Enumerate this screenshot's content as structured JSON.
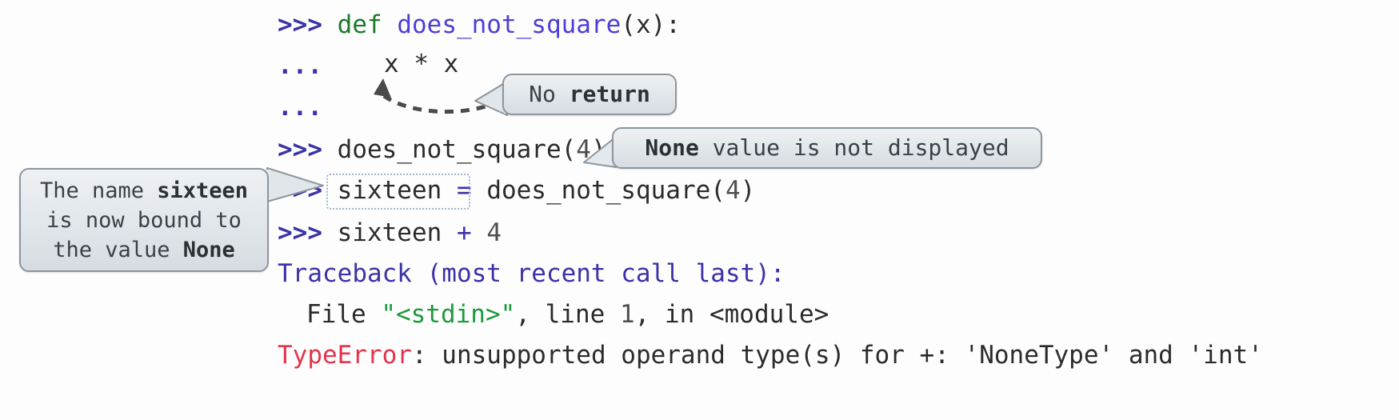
{
  "console": {
    "lines": [
      {
        "id": "def-line",
        "prompt": ">>> ",
        "keyword": "def ",
        "funcname": "does_not_square",
        "rest": "(x):"
      },
      {
        "id": "cont-line-1",
        "prompt": "... ",
        "body": ""
      },
      {
        "id": "cont-line-2",
        "prompt": "... ",
        "body": ""
      },
      {
        "id": "call-line",
        "prompt": ">>> ",
        "body": "does_not_square(4)"
      },
      {
        "id": "assign-line",
        "prompt": ">>> ",
        "body": "sixteen = does_not_square(4)"
      },
      {
        "id": "add-line",
        "prompt": ">>> ",
        "body": "sixteen + 4"
      },
      {
        "id": "traceback-line",
        "prompt": "",
        "body": "Traceback (most recent call last):"
      },
      {
        "id": "file-line",
        "prompt": "",
        "body": "File \"<stdin>\", line 1, in <module>"
      },
      {
        "id": "error-line",
        "prompt": "",
        "body": "TypeError: unsupported operand type(s) for +: 'NoneType' and 'int'"
      }
    ],
    "body_expr": "x * x",
    "def_prompt": ">>> ",
    "def_keyword": "def",
    "def_funcname": "does_not_square",
    "def_paren_open": "(",
    "def_arg": "x",
    "def_paren_close": "):",
    "cont_prompt": "...",
    "call_prompt": ">>> ",
    "call_name": "does_not_square",
    "call_open": "(",
    "call_arg": "4",
    "call_close": ")",
    "assign_prompt": ">>> ",
    "assign_target": "sixteen",
    "assign_op": " = ",
    "assign_call_name": "does_not_square",
    "assign_open": "(",
    "assign_arg": "4",
    "assign_close": ")",
    "add_prompt": ">>> ",
    "add_target": "sixteen",
    "add_op": " + ",
    "add_num": "4",
    "traceback_text": "Traceback (most recent call last):",
    "file_word": "File ",
    "file_name": "\"<stdin>\"",
    "file_mid": ", line ",
    "file_lineno": "1",
    "file_tail": ", in <module>",
    "error_name": "TypeError",
    "error_message": ": unsupported operand type(s) for +: 'NoneType' and 'int'"
  },
  "callouts": {
    "no_return": {
      "prefix": "No ",
      "bold": "return"
    },
    "none_value": {
      "bold": "None",
      "suffix": " value is not displayed"
    },
    "sixteen_binding": {
      "line1_a": "The name ",
      "line1_b": "sixteen",
      "line2": "is now bound to",
      "line3_a": "the value ",
      "line3_b": "None"
    }
  },
  "colors": {
    "prompt": "#3b32a8",
    "keyword_green": "#1d7a29",
    "function_purple": "#4d3fd6",
    "traceback_blue": "#3b32a8",
    "string_green": "#1d9a3e",
    "error_red": "#e2344b",
    "text": "#2b2b2b",
    "callout_bg": "#e4e9ed",
    "callout_border": "#8d969e",
    "highlight_border": "#9fb6cd",
    "background": "#fdfdfd"
  },
  "annotations": {
    "arrow": "dashed-curved-arrow-to-expression",
    "highlight_box": "sixteen-assignment-highlight"
  }
}
